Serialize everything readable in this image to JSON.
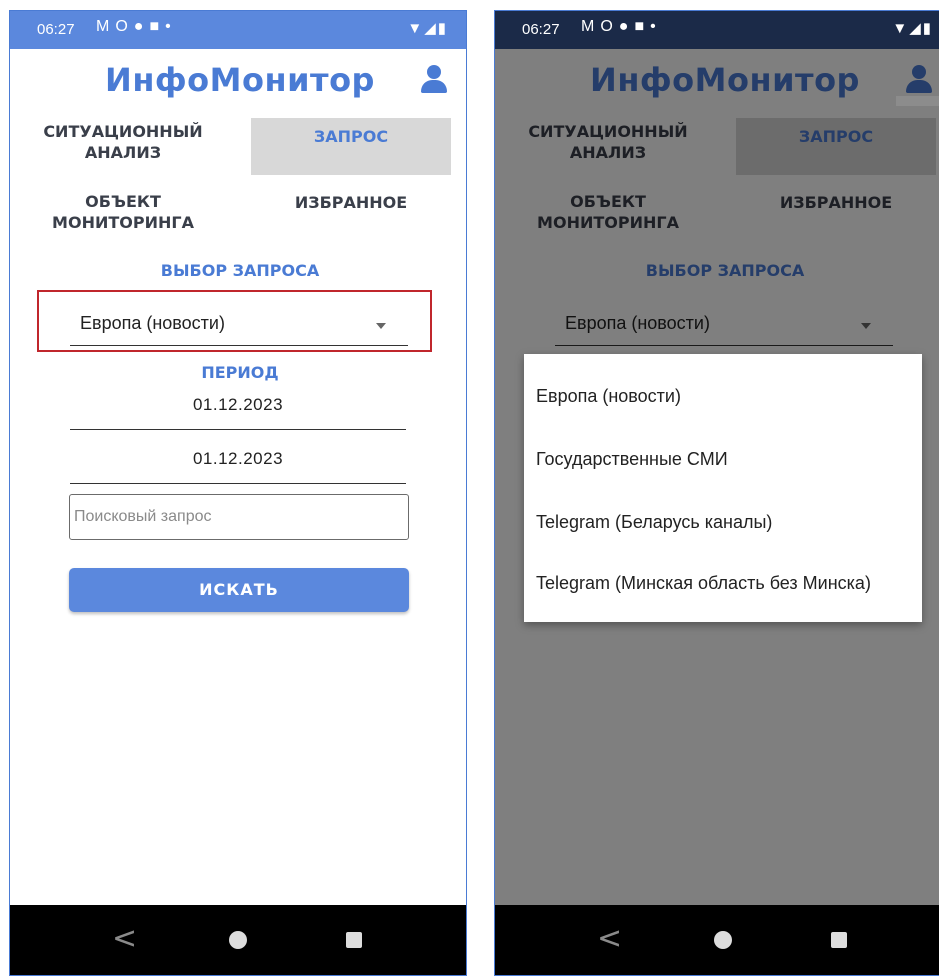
{
  "status_bar": {
    "time": "06:27",
    "icons": [
      "gmail-icon",
      "o-icon",
      "a-icon",
      "person-icon",
      "dot-icon"
    ],
    "right_icons": [
      "wifi-icon",
      "signal-icon",
      "battery-icon"
    ]
  },
  "app": {
    "title": "ИнфоМонитор"
  },
  "tabs": [
    {
      "label": "СИТУАЦИОННЫЙ АНАЛИЗ",
      "active": false
    },
    {
      "label": "ЗАПРОС",
      "active": true
    },
    {
      "label": "ОБЪЕКТ МОНИТОРИНГА",
      "active": false
    },
    {
      "label": "ИЗБРАННОЕ",
      "active": false
    }
  ],
  "query_select": {
    "label": "ВЫБОР ЗАПРОСА",
    "value": "Европа (новости)"
  },
  "period": {
    "label": "ПЕРИОД",
    "date_from": "01.12.2023",
    "date_to": "01.12.2023"
  },
  "search": {
    "placeholder": "Поисковый запрос",
    "button_label": "ИСКАТЬ"
  },
  "dropdown_options": [
    "Европа (новости)",
    "Государственные СМИ",
    "Telegram (Беларусь каналы)",
    "Telegram (Минская область без Минска)"
  ],
  "colors": {
    "accent": "#4a7bd4",
    "button": "#5b88dd",
    "highlight": "#c0262c",
    "status_dark": "#1b2a48"
  }
}
